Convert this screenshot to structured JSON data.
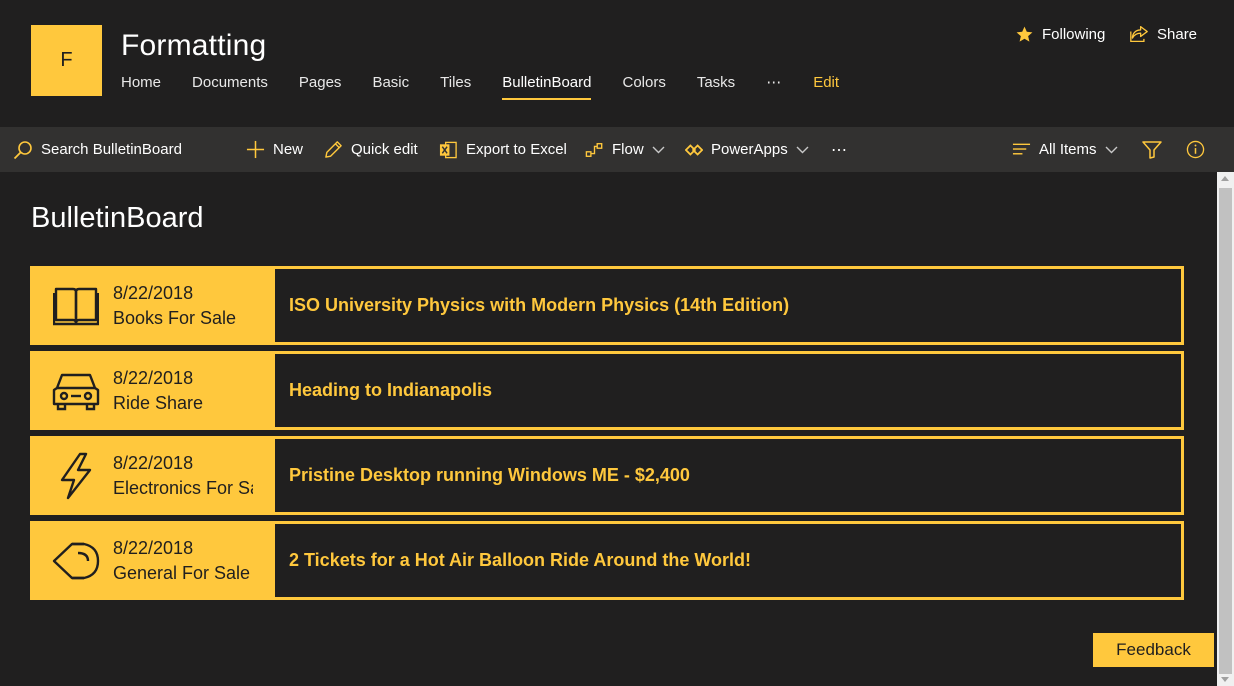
{
  "site": {
    "logo_letter": "F",
    "title": "Formatting"
  },
  "nav": {
    "items": [
      {
        "label": "Home"
      },
      {
        "label": "Documents"
      },
      {
        "label": "Pages"
      },
      {
        "label": "Basic"
      },
      {
        "label": "Tiles"
      },
      {
        "label": "BulletinBoard",
        "active": true
      },
      {
        "label": "Colors"
      },
      {
        "label": "Tasks"
      },
      {
        "label": "⋯"
      },
      {
        "label": "Edit"
      }
    ]
  },
  "header_actions": {
    "following": "Following",
    "share": "Share"
  },
  "command_bar": {
    "search": "Search BulletinBoard",
    "new": "New",
    "quick_edit": "Quick edit",
    "export": "Export to Excel",
    "flow": "Flow",
    "powerapps": "PowerApps",
    "more": "⋯",
    "view": "All Items"
  },
  "page": {
    "title": "BulletinBoard"
  },
  "items": [
    {
      "date": "8/22/2018",
      "category": "Books For Sale",
      "title": "ISO University Physics with Modern Physics (14th Edition)",
      "icon": "book-icon"
    },
    {
      "date": "8/22/2018",
      "category": "Ride Share",
      "title": "Heading to Indianapolis",
      "icon": "car-icon"
    },
    {
      "date": "8/22/2018",
      "category": "Electronics For Sale",
      "title": "Pristine Desktop running Windows ME - $2,400",
      "icon": "lightning-icon"
    },
    {
      "date": "8/22/2018",
      "category": "General For Sale",
      "title": "2 Tickets for a Hot Air Balloon Ride Around the World!",
      "icon": "tag-icon"
    }
  ],
  "feedback": "Feedback",
  "colors": {
    "accent": "#ffc83d",
    "background": "#201f1f",
    "command_bar": "#323130"
  }
}
